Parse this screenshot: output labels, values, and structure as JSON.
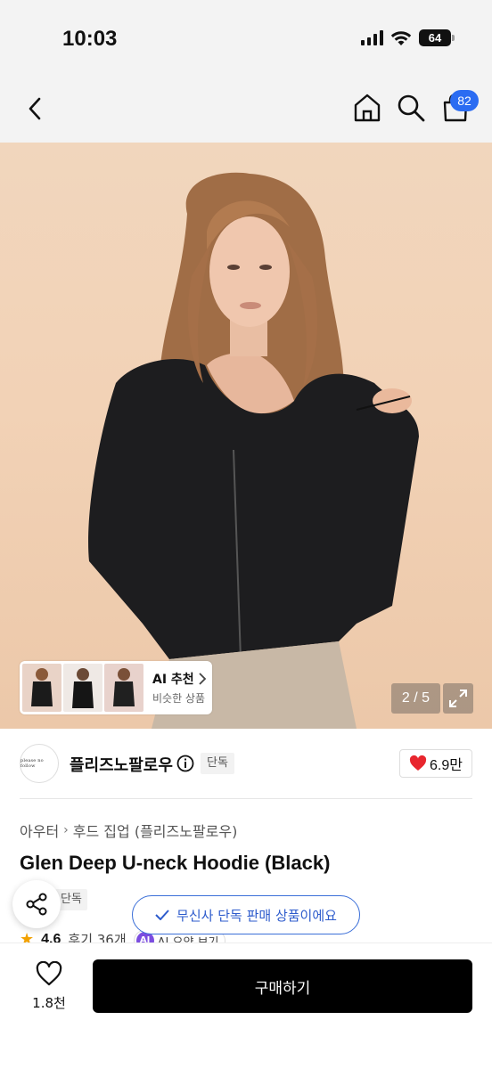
{
  "status_bar": {
    "time": "10:03",
    "battery": "64"
  },
  "nav": {
    "cart_count": "82"
  },
  "gallery": {
    "ai_title": "AI 추천",
    "ai_subtitle": "비슷한 상품",
    "pager": "2 / 5"
  },
  "brand": {
    "name": "플리즈노팔로우",
    "logo_text": "please no follow",
    "tag": "단독",
    "likes": "6.9만"
  },
  "breadcrumb": {
    "category": "아우터",
    "subcategory": "후드 집업 (플리즈노팔로우)"
  },
  "product": {
    "title": "Glen Deep U-neck Hoodie (Black)",
    "tag": "단독",
    "rating": "4.6",
    "reviews": "후기 36개",
    "ai_summary": "AI 요약 보기"
  },
  "toast": {
    "text": "무신사 단독 판매 상품이에요"
  },
  "bottom": {
    "wish_count": "1.8천",
    "buy_label": "구매하기"
  },
  "colors": {
    "accent_blue": "#2b6cf2",
    "heart_red": "#e8262e",
    "buy_black": "#000000"
  },
  "icons": [
    "back-icon",
    "home-icon",
    "search-icon",
    "cart-icon",
    "chevron-right-icon",
    "expand-icon",
    "info-icon",
    "heart-icon",
    "share-icon",
    "check-icon",
    "star-icon"
  ]
}
